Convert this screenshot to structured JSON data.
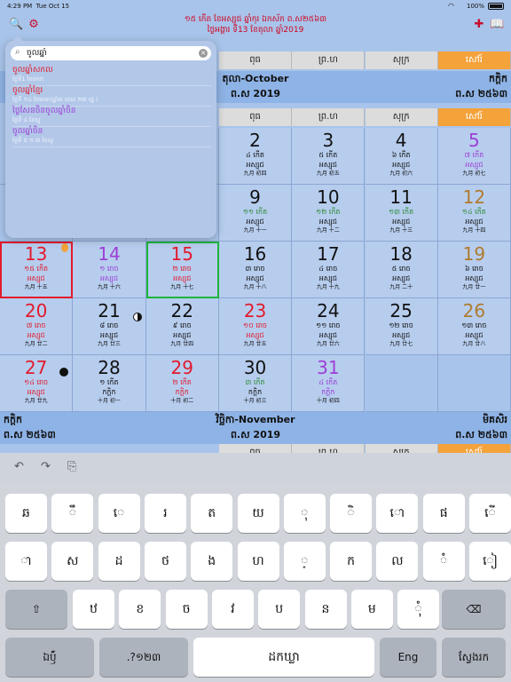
{
  "status": {
    "time": "4:29 PM",
    "date": "Tue Oct 15",
    "battery": "100%",
    "wifi_icon": "wifi-icon",
    "battery_icon": "battery-icon"
  },
  "header": {
    "line1": "១៥ កើត ខែអស្សុជ ឆ្នាំកុរ ឯកស័ក ព.ស២៥៦៣",
    "line2": "ថ្ងៃអង្គារ ទី13 ខែតុលា ឆ្នាំ2019",
    "icons": [
      "search-doc-icon",
      "gear-icon",
      "calendar-cross-icon",
      "book-icon"
    ]
  },
  "weekdays_top": [
    "ពុធ",
    "ព្រ.ហ",
    "សុក្រ",
    "សៅរ៍"
  ],
  "weekdays_mid": [
    "ពុធ",
    "ព្រ.ហ",
    "សុក្រ",
    "សៅរ៍"
  ],
  "october_bar": {
    "left1": "",
    "left2": "",
    "center1": "តុលា-October",
    "center2": "ព.ស 2019",
    "right1": "កក្ដិក",
    "right2": "ព.ស ២៥៦៣"
  },
  "november_bar": {
    "left1": "កក្ដិក",
    "left2": "ព.ស ២៥៦៣",
    "center1": "វិច្ឆិកា-November",
    "center2": "ព.ស 2019",
    "right1": "មិគសិរ",
    "right2": "ព.ស ២៥៦៣"
  },
  "rows": [
    [
      null,
      null,
      null,
      {
        "n": "2",
        "l": "៤ កើត",
        "s": "អស្សុជ",
        "c": "九月 初四"
      },
      {
        "n": "3",
        "l": "៥ កើត",
        "s": "អស្សុជ",
        "c": "九月 初五"
      },
      {
        "n": "4",
        "l": "៦ កើត",
        "s": "អស្សុជ",
        "c": "九月 初六"
      },
      {
        "n": "5",
        "l": "៧ កើត",
        "s": "អស្សុជ",
        "c": "九月 初七",
        "sat": true
      }
    ],
    [
      null,
      null,
      null,
      {
        "n": "9",
        "l": "១១ កើត",
        "s": "អស្សុជ",
        "c": "九月 十一",
        "green": true
      },
      {
        "n": "10",
        "l": "១២ កើត",
        "s": "អស្សុជ",
        "c": "九月 十二",
        "green": true
      },
      {
        "n": "11",
        "l": "១៣ កើត",
        "s": "អស្សុជ",
        "c": "九月 十三",
        "green": true
      },
      {
        "n": "12",
        "l": "១៤ កើត",
        "s": "អស្សុជ",
        "c": "九月 十四",
        "gold": true,
        "green": true
      }
    ],
    [
      {
        "n": "13",
        "l": "១៥ កើត",
        "s": "អស្សុជ",
        "c": "九月 十五",
        "hol": true,
        "today": true,
        "badge": "flame"
      },
      {
        "n": "14",
        "l": "១ រោច",
        "s": "អស្សុជ",
        "c": "九月 十六",
        "sat": true
      },
      {
        "n": "15",
        "l": "២ រោច",
        "s": "អស្សុជ",
        "c": "九月 十七",
        "hol": true,
        "selected": true
      },
      {
        "n": "16",
        "l": "៣ រោច",
        "s": "អស្សុជ",
        "c": "九月 十八"
      },
      {
        "n": "17",
        "l": "៤ រោច",
        "s": "អស្សុជ",
        "c": "九月 十九"
      },
      {
        "n": "18",
        "l": "៥ រោច",
        "s": "អស្សុជ",
        "c": "九月 二十"
      },
      {
        "n": "19",
        "l": "៦ រោច",
        "s": "អស្សុជ",
        "c": "九月 廿一",
        "gold": true
      }
    ],
    [
      {
        "n": "20",
        "l": "៧ រោច",
        "s": "អស្សុជ",
        "c": "九月 廿二",
        "hol": true
      },
      {
        "n": "21",
        "l": "៨ រោច",
        "s": "អស្សុជ",
        "c": "九月 廿三",
        "badge": "moon-half"
      },
      {
        "n": "22",
        "l": "៩ រោច",
        "s": "អស្សុជ",
        "c": "九月 廿四"
      },
      {
        "n": "23",
        "l": "១០ រោច",
        "s": "អស្សុជ",
        "c": "九月 廿五",
        "hol": true
      },
      {
        "n": "24",
        "l": "១១ រោច",
        "s": "អស្សុជ",
        "c": "九月 廿六"
      },
      {
        "n": "25",
        "l": "១២ រោច",
        "s": "អស្សុជ",
        "c": "九月 廿七"
      },
      {
        "n": "26",
        "l": "១៣ រោច",
        "s": "អស្សុជ",
        "c": "九月 廿八",
        "gold": true
      }
    ],
    [
      {
        "n": "27",
        "l": "១៤ រោច",
        "s": "អស្សុជ",
        "c": "九月 廿九",
        "hol": true,
        "badge": "moon-full"
      },
      {
        "n": "28",
        "l": "១ កើត",
        "s": "កក្ដិក",
        "c": "十月 初一"
      },
      {
        "n": "29",
        "l": "២ កើត",
        "s": "កក្ដិក",
        "c": "十月 初二",
        "hol": true
      },
      {
        "n": "30",
        "l": "៣ កើត",
        "s": "កក្ដិក",
        "c": "十月 初三",
        "green": true
      },
      {
        "n": "31",
        "l": "៤ កើត",
        "s": "កក្ដិក",
        "c": "十月 初四",
        "sat": true
      },
      null,
      null
    ]
  ],
  "search": {
    "query": "ចូលឆ្នាំ",
    "results": [
      {
        "title": "ចូលឆ្នាំសកល",
        "sub": "ថ្ងៃទី1 ខែមករា",
        "purple": false
      },
      {
        "title": "ចូលឆ្នាំខ្មែរ",
        "sub": "ថ្ងៃទី ១៤ ខែមករា(ឆ្នាំ៣ ដេយ ២៣ រដ្ឋ )",
        "purple": false
      },
      {
        "title": "ថ្ងៃសែនចិនចូលឆ្នាំចិន",
        "sub": "ថ្ងៃទី ៤ ខែស្ពុ",
        "purple": true
      },
      {
        "title": "ចូលឆ្នាំចិន",
        "sub": "ថ្ងៃទី ៥.១.៣ ខែស្ពុ",
        "purple": true
      }
    ]
  },
  "toolbar": {
    "undo": "↶",
    "redo": "↷",
    "paste": "⎘"
  },
  "keyboard": {
    "row1": [
      "ឆ",
      "ឹ",
      "េ",
      "រ",
      "ត",
      "យ",
      "ុ",
      "ិ",
      "ោ",
      "ផ",
      "ើ"
    ],
    "row2": [
      "ា",
      "ស",
      "ដ",
      "ថ",
      "ង",
      "ហ",
      "្",
      "ក",
      "ល",
      "ំ",
      "ៀ"
    ],
    "row3": [
      "⇧",
      "ឋ",
      "ខ",
      "ច",
      "វ",
      "ប",
      "ន",
      "ម",
      "ុំ",
      "⌫"
    ],
    "row4": [
      "ឯឫ៍ំ",
      ".?១២៣",
      "ដកឃ្លា",
      "Eng",
      "ស្វែងរក"
    ]
  }
}
